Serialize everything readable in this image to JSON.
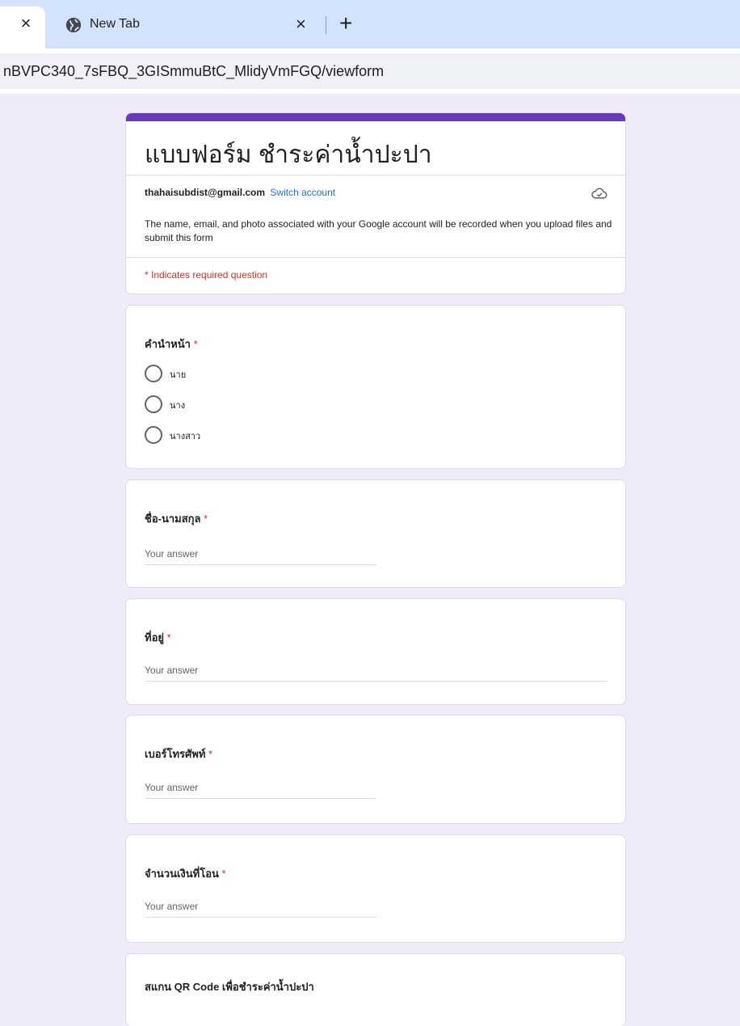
{
  "browser": {
    "active_tab_close": "×",
    "tabs": [
      {
        "title": "New Tab",
        "close": "×"
      }
    ],
    "new_tab_button": "+",
    "url": "nBVPC340_7sFBQ_3GISmmuBtC_MlidyVmFGQ/viewform"
  },
  "form": {
    "accent_color": "#673ab7",
    "background_color": "#f0ebf8",
    "title": "แบบฟอร์ม ชำระค่าน้ำปะปา",
    "account_email": "thahaisubdist@gmail.com",
    "switch_account": "Switch account",
    "notice": "The name, email, and photo associated with your Google account will be recorded when you upload files and submit this form",
    "required_note": "* Indicates required question",
    "questions": [
      {
        "title": "คำนำหน้า",
        "required": "*",
        "type": "radio",
        "options": [
          "นาย",
          "นาง",
          "นางสาว"
        ]
      },
      {
        "title": "ชื่อ-นามสกุล",
        "required": "*",
        "type": "short",
        "placeholder": "Your answer"
      },
      {
        "title": "ที่อยู่",
        "required": "*",
        "type": "long",
        "placeholder": "Your answer"
      },
      {
        "title": "เบอร์โทรศัพท์",
        "required": "*",
        "type": "short",
        "placeholder": "Your answer"
      },
      {
        "title": "จำนวนเงินที่โอน",
        "required": "*",
        "type": "short",
        "placeholder": "Your answer"
      },
      {
        "title": "สแกน QR Code เพื่อชำระค่าน้ำปะปา",
        "type": "section"
      }
    ]
  }
}
